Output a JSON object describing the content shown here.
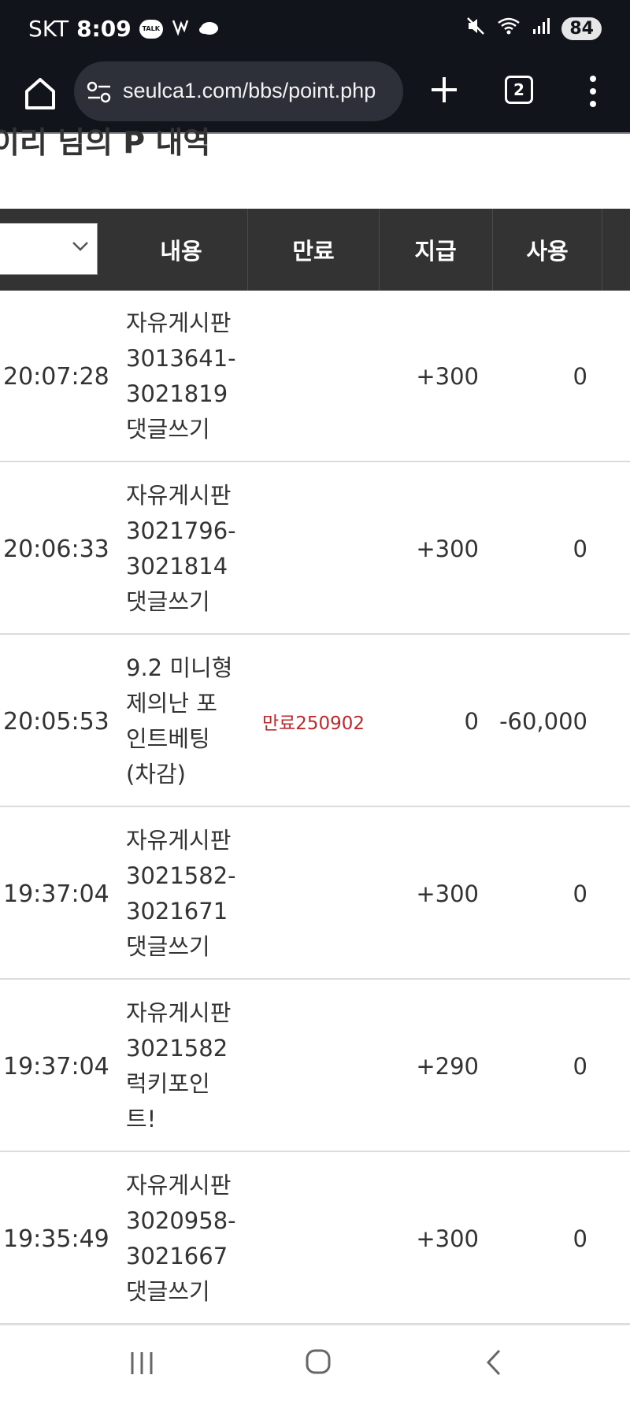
{
  "status_bar": {
    "carrier": "SKT",
    "time": "8:09",
    "talk_badge": "TALK",
    "battery": "84",
    "icons": [
      "kakaotalk-icon",
      "vpn-icon",
      "cloud-icon",
      "mute-icon",
      "wifi-icon",
      "signal-icon"
    ]
  },
  "browser": {
    "url": "seulca1.com/bbs/point.php",
    "tab_count": "2",
    "icons": [
      "home-icon",
      "site-settings-icon",
      "plus-icon",
      "tabs-icon",
      "more-icon"
    ]
  },
  "page": {
    "heading": "이리 님의 P 내역"
  },
  "table": {
    "headers": {
      "content": "내용",
      "expire": "만료",
      "give": "지급",
      "use": "사용"
    },
    "rows": [
      {
        "time": "20:07:28",
        "content": [
          "자유게시판",
          "3013641-",
          "3021819",
          "댓글쓰기"
        ],
        "expire": "",
        "give": "+300",
        "use": "0"
      },
      {
        "time": "20:06:33",
        "content": [
          "자유게시판",
          "3021796-",
          "3021814",
          "댓글쓰기"
        ],
        "expire": "",
        "give": "+300",
        "use": "0"
      },
      {
        "time": "20:05:53",
        "content": [
          "9.2 미니형",
          "제의난 포",
          "인트베팅",
          "(차감)"
        ],
        "expire": "만료250902",
        "give": "0",
        "use": "-60,000"
      },
      {
        "time": "19:37:04",
        "content": [
          "자유게시판",
          "3021582-",
          "3021671",
          "댓글쓰기"
        ],
        "expire": "",
        "give": "+300",
        "use": "0"
      },
      {
        "time": "19:37:04",
        "content": [
          "자유게시판",
          "3021582",
          "럭키포인",
          "트!"
        ],
        "expire": "",
        "give": "+290",
        "use": "0"
      },
      {
        "time": "19:35:49",
        "content": [
          "자유게시판",
          "3020958-",
          "3021667",
          "댓글쓰기"
        ],
        "expire": "",
        "give": "+300",
        "use": "0"
      }
    ]
  },
  "nav_bar": {
    "icons": [
      "recent-apps-icon",
      "home-circle-icon",
      "back-icon"
    ]
  },
  "colors": {
    "status_bg": "#12141b",
    "header_bg": "#333333",
    "expire_text": "#c0282c"
  }
}
